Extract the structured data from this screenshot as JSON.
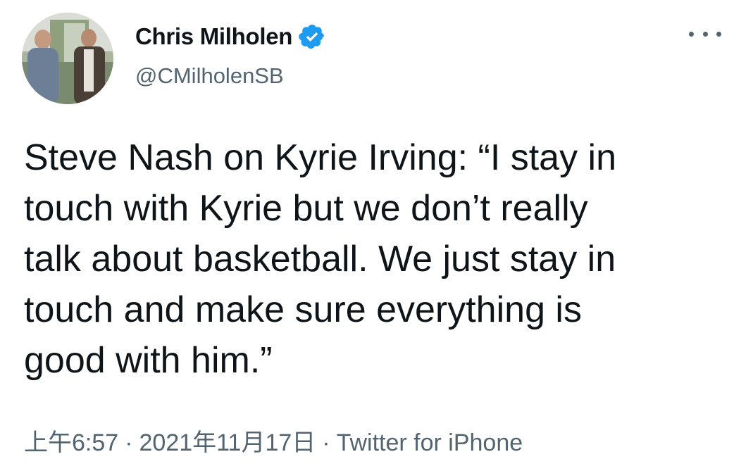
{
  "author": {
    "display_name": "Chris Milholen",
    "handle": "@CMilholenSB",
    "verified_color": "#1d9bf0"
  },
  "tweet": {
    "lines": [
      "Steve Nash on Kyrie Irving: “I stay in",
      "touch with Kyrie but we don’t really",
      "talk about basketball. We just stay in",
      "touch and make sure everything is",
      "good with him.”"
    ]
  },
  "meta": {
    "time": "上午6:57",
    "separator": "·",
    "date": "2021年11月17日",
    "source": "Twitter for iPhone"
  },
  "icons": {
    "more": "more-options-icon",
    "verified": "verified-badge-icon"
  }
}
